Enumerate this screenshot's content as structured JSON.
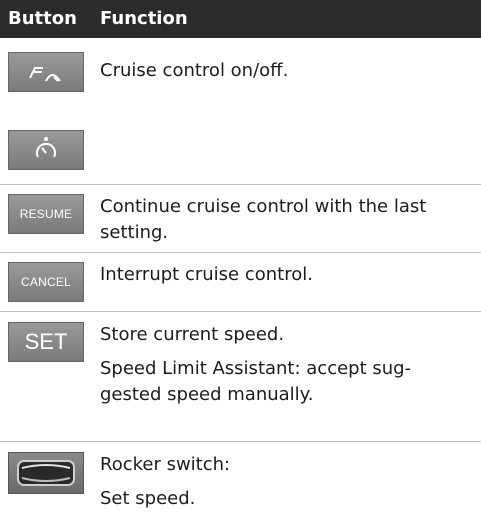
{
  "header": {
    "col1": "Button",
    "col2": "Function"
  },
  "rows": [
    {
      "icon": "cruise-control-onoff-icon",
      "texts": [
        "Cruise control on/off."
      ]
    },
    {
      "icon": "speedometer-icon",
      "texts": []
    },
    {
      "button_label": "RESUME",
      "texts": [
        "Continue cruise control with the last",
        "setting."
      ]
    },
    {
      "button_label": "CANCEL",
      "texts": [
        "Interrupt cruise control."
      ]
    },
    {
      "button_label": "SET",
      "texts": [
        "Store current speed.",
        "Speed Limit Assistant: accept sug-",
        "gested speed manually."
      ]
    },
    {
      "icon": "rocker-switch-icon",
      "texts": [
        "Rocker switch:",
        "Set speed."
      ]
    }
  ],
  "colors": {
    "header_bg": "#2b2b2b",
    "button_bg": "#888888",
    "divider": "#bfbfbf"
  }
}
